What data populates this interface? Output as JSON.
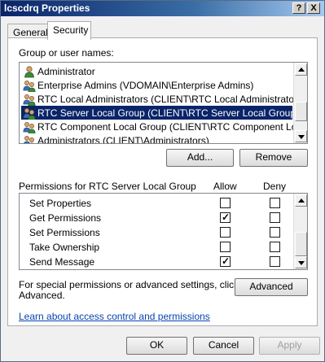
{
  "window": {
    "title": "lcscdrq Properties"
  },
  "title_buttons": {
    "help": "?",
    "close": "X"
  },
  "tabs": [
    {
      "label": "General"
    },
    {
      "label": "Security"
    }
  ],
  "security": {
    "group_label": "Group or user names:",
    "users": [
      {
        "name": "Administrator",
        "icon": "user-icon"
      },
      {
        "name": "Enterprise Admins (VDOMAIN\\Enterprise Admins)",
        "icon": "group-icon"
      },
      {
        "name": "RTC Local Administrators (CLIENT\\RTC Local Administrators)",
        "icon": "group-icon"
      },
      {
        "name": "RTC Server Local Group (CLIENT\\RTC Server Local Group)",
        "icon": "group-icon",
        "selected": true
      },
      {
        "name": "RTC Component Local Group (CLIENT\\RTC Component Local ...",
        "icon": "group-icon"
      },
      {
        "name": "Administrators (CLIENT\\Administrators)",
        "icon": "group-icon"
      }
    ],
    "add_label": "Add...",
    "remove_label": "Remove",
    "permissions_label": "Permissions for RTC Server Local Group",
    "allow_header": "Allow",
    "deny_header": "Deny",
    "permissions": [
      {
        "name": "Set Properties",
        "allow": false,
        "deny": false
      },
      {
        "name": "Get Permissions",
        "allow": true,
        "deny": false
      },
      {
        "name": "Set Permissions",
        "allow": false,
        "deny": false
      },
      {
        "name": "Take Ownership",
        "allow": false,
        "deny": false
      },
      {
        "name": "Send Message",
        "allow": true,
        "deny": false
      }
    ],
    "advanced_text_line1": "For special permissions or advanced settings, click",
    "advanced_text_line2": "Advanced.",
    "advanced_label": "Advanced",
    "learn_link": "Learn about access control and permissions"
  },
  "footer": {
    "ok": "OK",
    "cancel": "Cancel",
    "apply": "Apply"
  },
  "colors": {
    "title_bar": "#0a246a",
    "selection": "#0a246a",
    "link": "#0645ad"
  }
}
